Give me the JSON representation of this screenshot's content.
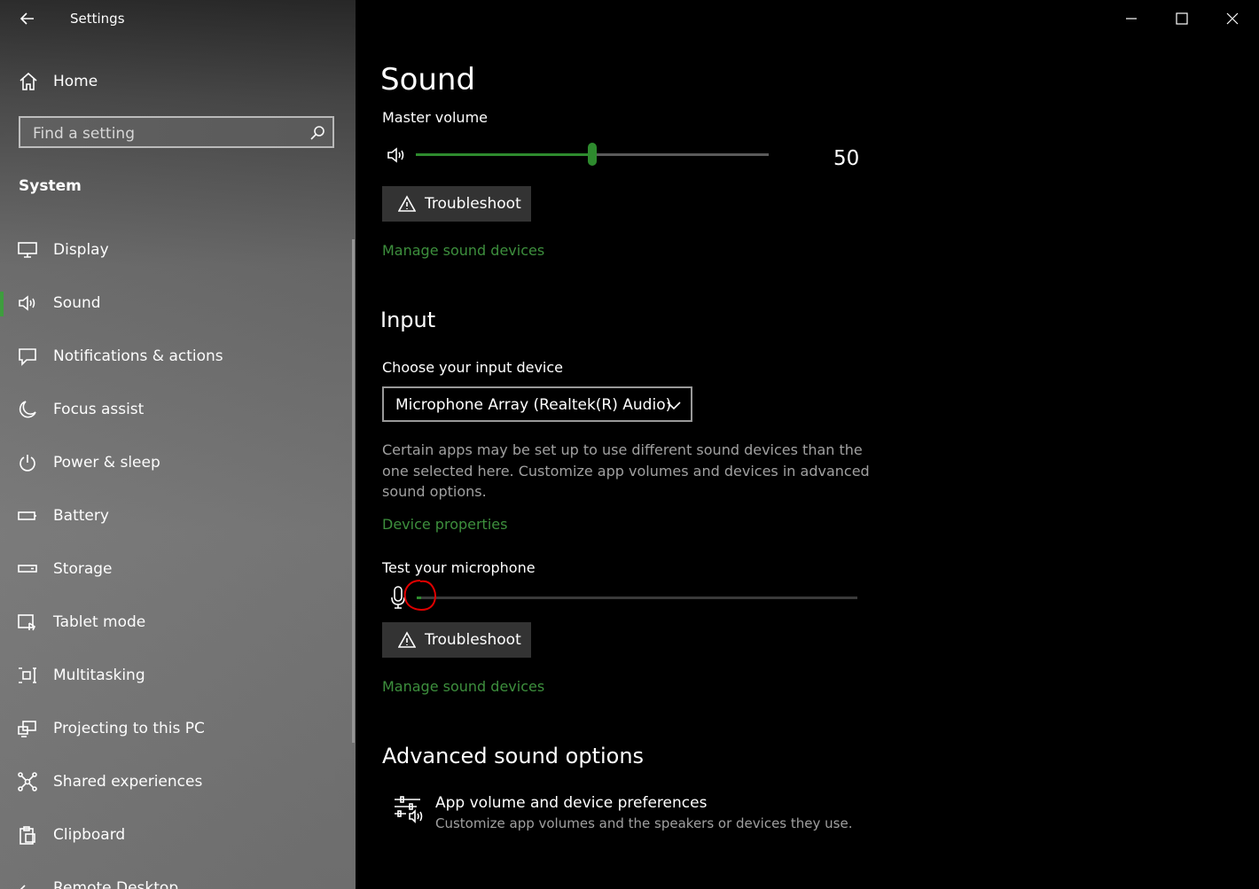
{
  "window": {
    "title": "Settings",
    "controls": [
      "minimize-icon",
      "maximize-icon",
      "close-icon"
    ]
  },
  "sidebar": {
    "home_label": "Home",
    "search": {
      "placeholder": "Find a setting",
      "value": ""
    },
    "section_title": "System",
    "items": [
      {
        "label": "Display",
        "icon": "display-icon",
        "active": false
      },
      {
        "label": "Sound",
        "icon": "speaker-icon",
        "active": true
      },
      {
        "label": "Notifications & actions",
        "icon": "notification-icon",
        "active": false
      },
      {
        "label": "Focus assist",
        "icon": "moon-icon",
        "active": false
      },
      {
        "label": "Power & sleep",
        "icon": "power-icon",
        "active": false
      },
      {
        "label": "Battery",
        "icon": "battery-icon",
        "active": false
      },
      {
        "label": "Storage",
        "icon": "storage-icon",
        "active": false
      },
      {
        "label": "Tablet mode",
        "icon": "tablet-mode-icon",
        "active": false
      },
      {
        "label": "Multitasking",
        "icon": "multitasking-icon",
        "active": false
      },
      {
        "label": "Projecting to this PC",
        "icon": "projecting-icon",
        "active": false
      },
      {
        "label": "Shared experiences",
        "icon": "shared-experiences-icon",
        "active": false
      },
      {
        "label": "Clipboard",
        "icon": "clipboard-icon",
        "active": false
      },
      {
        "label": "Remote Desktop",
        "icon": "remote-desktop-icon",
        "active": false
      }
    ]
  },
  "main": {
    "page_title": "Sound",
    "output": {
      "master_volume_label": "Master volume",
      "master_volume_value": "50",
      "volume_fraction": 0.5,
      "troubleshoot_label": "Troubleshoot",
      "manage_devices_label": "Manage sound devices"
    },
    "input": {
      "heading": "Input",
      "choose_device_label": "Choose your input device",
      "selected_device": "Microphone Array (Realtek(R) Audio)",
      "description": "Certain apps may be set up to use different sound devices than the one selected here. Customize app volumes and devices in advanced sound options.",
      "device_properties_label": "Device properties",
      "test_mic_label": "Test your microphone",
      "mic_level_fraction": 0.01,
      "troubleshoot_label": "Troubleshoot",
      "manage_devices_label": "Manage sound devices"
    },
    "advanced": {
      "heading": "Advanced sound options",
      "pref_title": "App volume and device preferences",
      "pref_subtitle": "Customize app volumes and the speakers or devices they use."
    }
  },
  "colors": {
    "accent_green": "#2e8b2e",
    "link_green": "#3d8f3d",
    "annotation_red": "#e00000"
  }
}
